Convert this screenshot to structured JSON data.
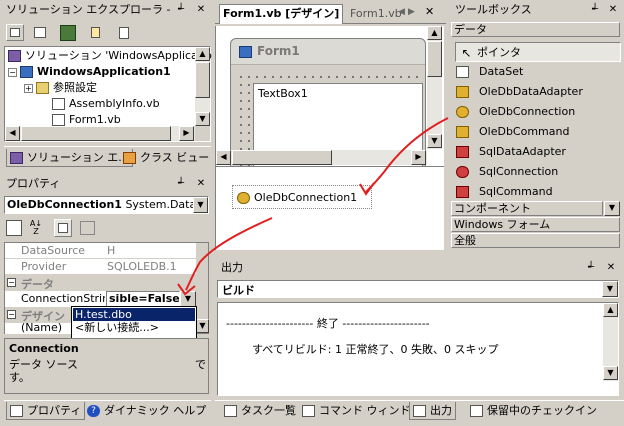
{
  "solution_explorer": {
    "title": "ソリューション エクスプローラ - Wi...",
    "pin": "ᴾ",
    "close": "×",
    "items": [
      {
        "label": "ソリューション 'WindowsApplicatio"
      },
      {
        "label": "WindowsApplication1"
      },
      {
        "label": "参照設定"
      },
      {
        "label": "AssemblyInfo.vb"
      },
      {
        "label": "Form1.vb"
      }
    ],
    "tabs": [
      "ソリューション エ...",
      "クラス ビュー"
    ]
  },
  "designer": {
    "tabs": [
      "Form1.vb [デザイン]",
      "Form1.vb"
    ],
    "form_title": "Form1",
    "textbox_text": "TextBox1",
    "component_label": "OleDbConnection1"
  },
  "toolbox": {
    "title": "ツールボックス",
    "group_data": "データ",
    "items": [
      {
        "label": "ポインタ",
        "icon": "pointer-icon"
      },
      {
        "label": "DataSet",
        "icon": "dataset-icon"
      },
      {
        "label": "OleDbDataAdapter",
        "icon": "oledbdataadapter-icon"
      },
      {
        "label": "OleDbConnection",
        "icon": "oledbconnection-icon"
      },
      {
        "label": "OleDbCommand",
        "icon": "oledbcommand-icon"
      },
      {
        "label": "SqlDataAdapter",
        "icon": "sqldataadapter-icon"
      },
      {
        "label": "SqlConnection",
        "icon": "sqlconnection-icon"
      },
      {
        "label": "SqlCommand",
        "icon": "sqlcommand-icon"
      }
    ],
    "groups_bottom": [
      "コンポーネント",
      "Windows フォーム",
      "全般"
    ]
  },
  "properties": {
    "title": "プロパティ",
    "object": "OleDbConnection1",
    "object_type": "System.Data.C",
    "rows": [
      {
        "name": "DataSource",
        "value": "H"
      },
      {
        "name": "Provider",
        "value": "SQLOLEDB.1"
      }
    ],
    "cat_data": "データ",
    "conn_name": "ConnectionStrin",
    "conn_value": "sible=False",
    "cat_design": "デザイン",
    "name_row": "(Name)",
    "dropdown_options": [
      "H.test.dbo",
      "<新しい接続...>"
    ],
    "desc_title": "Connection",
    "desc_text1": "データ ソース",
    "desc_text2": "す。",
    "desc_tail": "で",
    "tabs": [
      "プロパティ",
      "ダイナミック ヘルプ"
    ]
  },
  "output": {
    "title": "出力",
    "dropdown": "ビルド",
    "line1": "---------------------- 終了 ----------------------",
    "line2": "すべてリビルド: 1 正常終了、0 失敗、0 スキップ"
  },
  "bottom_tabs": [
    "タスク一覧",
    "コマンド ウィンドウ",
    "出力",
    "保留中のチェックイン"
  ],
  "colors": {
    "annotation_arrow": "#e02020",
    "selection": "#0a246a"
  }
}
